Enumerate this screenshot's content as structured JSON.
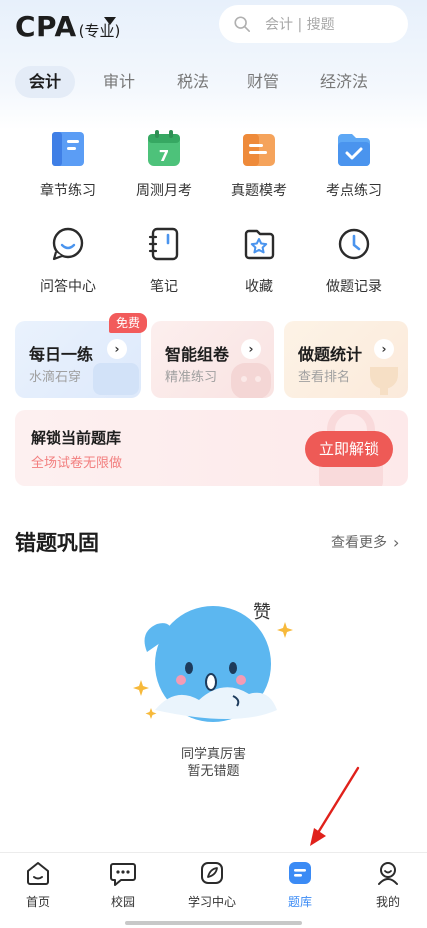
{
  "header": {
    "brand": "CPA",
    "brand_sub": "(专业)",
    "search_placeholder": "会计 | 搜题"
  },
  "tabs": [
    {
      "label": "会计",
      "active": true
    },
    {
      "label": "审计",
      "active": false
    },
    {
      "label": "税法",
      "active": false
    },
    {
      "label": "财管",
      "active": false
    },
    {
      "label": "经济法",
      "active": false
    }
  ],
  "grid": [
    {
      "label": "章节练习",
      "icon": "book-icon"
    },
    {
      "label": "周测月考",
      "icon": "calendar-icon",
      "icon_text": "7"
    },
    {
      "label": "真题模考",
      "icon": "exam-folder-icon"
    },
    {
      "label": "考点练习",
      "icon": "check-folder-icon"
    },
    {
      "label": "问答中心",
      "icon": "chat-icon"
    },
    {
      "label": "笔记",
      "icon": "notebook-icon"
    },
    {
      "label": "收藏",
      "icon": "star-icon"
    },
    {
      "label": "做题记录",
      "icon": "clock-icon"
    }
  ],
  "cards": [
    {
      "title": "每日一练",
      "sub": "水滴石穿",
      "badge": "免费"
    },
    {
      "title": "智能组卷",
      "sub": "精准练习"
    },
    {
      "title": "做题统计",
      "sub": "查看排名"
    }
  ],
  "unlock": {
    "title": "解锁当前题库",
    "sub": "全场试卷无限做",
    "button": "立即解锁"
  },
  "wrong_section": {
    "title": "错题巩固",
    "more": "查看更多",
    "praise": "赞",
    "empty_line1": "同学真厉害",
    "empty_line2": "暂无错题"
  },
  "bottom_nav": [
    {
      "label": "首页",
      "icon": "home-icon",
      "active": false
    },
    {
      "label": "校园",
      "icon": "campus-icon",
      "active": false
    },
    {
      "label": "学习中心",
      "icon": "study-icon",
      "active": false
    },
    {
      "label": "题库",
      "icon": "question-bank-icon",
      "active": true
    },
    {
      "label": "我的",
      "icon": "profile-icon",
      "active": false
    }
  ],
  "colors": {
    "accent_blue": "#3b8bf5",
    "unlock_red": "#ee5a56",
    "badge_red": "#f25b5b"
  }
}
